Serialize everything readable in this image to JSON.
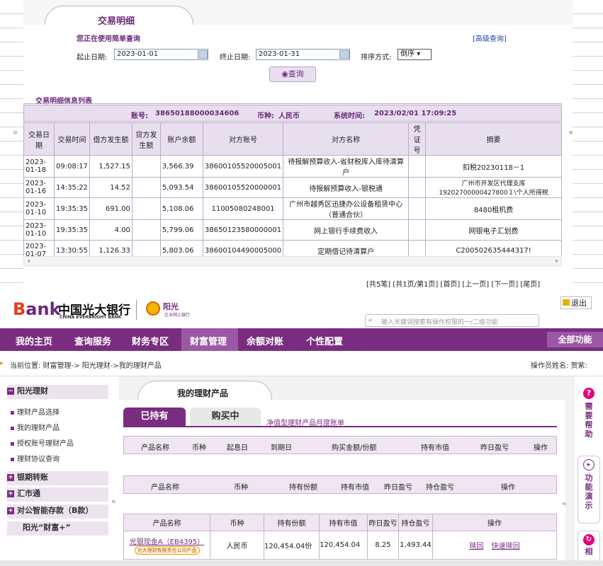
{
  "top_panel": {
    "tab_title": "交易明细",
    "simple_query_note": "您正在使用简单查询",
    "advanced_query_link": "[高级查询]",
    "start_date_label": "起止日期:",
    "start_date_value": "2023-01-01",
    "end_date_label": "终止日期:",
    "end_date_value": "2023-01-31",
    "sort_label": "排序方式:",
    "sort_value": "倒序",
    "query_button": "查询",
    "list_title": "交易明细信息列表",
    "info_line": {
      "account_label": "账号:",
      "account": "38650188000034606",
      "currency_label": "币种:",
      "currency": "人民币",
      "systime_label": "系统时间:",
      "systime": "2023/02/01 17:09:25"
    },
    "columns": [
      "交易日期",
      "交易时间",
      "借方发生额",
      "贷方发生额",
      "账户余额",
      "对方账号",
      "对方名称",
      "凭证号",
      "摘要"
    ],
    "rows": [
      {
        "date": "2023-01-18",
        "time": "09:08:17",
        "debit": "1,527.15",
        "credit": "",
        "balance": "3,566.39",
        "acct": "38600105520005001",
        "name": "待报解预算收入-省财税库入库待清算户",
        "voucher": "",
        "summary": "扣税20230118－1"
      },
      {
        "date": "2023-01-16",
        "time": "14:35:22",
        "debit": "14.52",
        "credit": "",
        "balance": "5,093.54",
        "acct": "38600105520000001",
        "name": "待报解预算收入-银税通",
        "voucher": "",
        "summary": "广州市开发区代理支库19202700000427800１\\个人所得税"
      },
      {
        "date": "2023-01-10",
        "time": "19:35:35",
        "debit": "691.00",
        "credit": "",
        "balance": "5,108.06",
        "acct": "11005080248001",
        "name": "广州市越秀区迅捷办公设备租赁中心（普通合伙）",
        "voucher": "",
        "summary": "8480租机费"
      },
      {
        "date": "2023-01-10",
        "time": "19:35:35",
        "debit": "4.00",
        "credit": "",
        "balance": "5,799.06",
        "acct": "38650123580000001",
        "name": "网上银行手续费收入",
        "voucher": "",
        "summary": "网银电子汇划费"
      },
      {
        "date": "2023-01-07",
        "time": "13:30:55",
        "debit": "1,126.33",
        "credit": "",
        "balance": "5,803.06",
        "acct": "38600104490005000",
        "name": "定期借记待清算户",
        "voucher": "",
        "summary": "C200502635444317!"
      }
    ],
    "pager": "[共5笔] [共1页/第1页] [首页] [上一页] [下一页] [尾页]",
    "left_arrow": "»",
    "right_arrow": "«"
  },
  "header": {
    "logo_text": "ank",
    "logo_letter": "B",
    "bank_cn": "中国光大银行",
    "bank_en": "CHINA EVERBRIGHT BANK",
    "sub_logo": "阳光",
    "sub_logo_small": "企业网上银行",
    "search_placeholder": "输入关键词搜索有操作权限的一/二级功能",
    "logout": "退出"
  },
  "nav": {
    "items": [
      "我的主页",
      "查询服务",
      "财务专区",
      "财富管理",
      "余额对账",
      "个性配置"
    ],
    "active_index": 3,
    "all_functions": "全部功能"
  },
  "breadcrumb": {
    "text": "当前位置: 财富管理-> 阳光理财->我的理财产品",
    "operator": "操作员姓名: 贺紫:"
  },
  "sidebar": {
    "head1": "阳光理财",
    "items": [
      "理财产品选择",
      "我的理财产品",
      "授权账号理财产品",
      "理财协议查询"
    ],
    "groups": [
      "银期转账",
      "汇市通",
      "对公智能存款（B款）",
      "阳光“财富+”"
    ],
    "collapse": "«"
  },
  "main": {
    "tab_title": "我的理财产品",
    "tab_holding": "已持有",
    "tab_buying": "购买中",
    "monthly_link": "净值型理财产品月度账单",
    "header1": [
      "产品名称",
      "币种",
      "起息日",
      "到期日",
      "购买金额/份额",
      "持有市值",
      "昨日盈亏",
      "操作"
    ],
    "header2": [
      "产品名称",
      "币种",
      "持有份额",
      "持有市值",
      "昨日盈亏",
      "持仓盈亏",
      "操作"
    ],
    "header3": [
      "产品名称",
      "币种",
      "持有份额",
      "持有市值",
      "昨日盈亏",
      "持仓盈亏",
      "操作"
    ],
    "product": {
      "name": "光银现金A（EB4395）",
      "issuer": "光大理财有限责任公司产品",
      "currency": "人民币",
      "shares": "120,454.04份",
      "value": "120,454.04",
      "yesterday": "8.25",
      "position": "1,493.44",
      "redeem": "赎回",
      "quick_redeem": "快速赎回"
    },
    "collapse": "«"
  },
  "rightbar": {
    "help": "需要帮助",
    "demo": "功能演示",
    "more": "相"
  },
  "colors": {
    "brand_purple": "#7a2d80",
    "link_blue": "#2040a0"
  }
}
